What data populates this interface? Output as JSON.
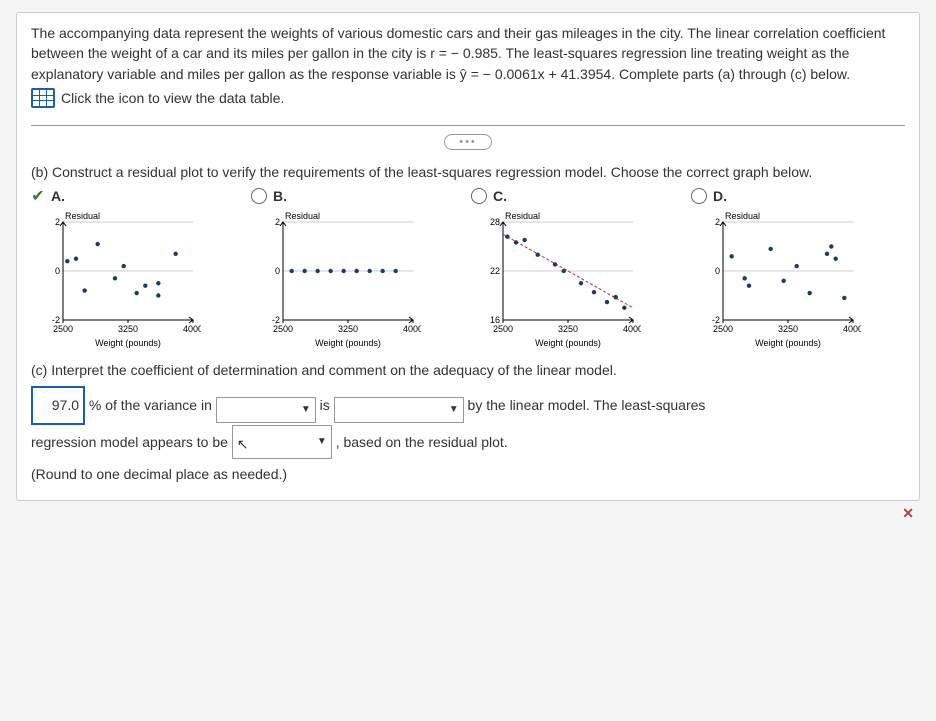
{
  "problem": {
    "p1": "The accompanying data represent the weights of various domestic cars and their gas mileages in the city. The linear correlation coefficient between the weight of a car and its miles per gallon in the city is r = − 0.985. The least-squares regression line treating weight as the explanatory variable and miles per gallon as the response variable is ŷ = − 0.0061x + 41.3954. Complete parts (a) through (c) below.",
    "data_link": "Click the icon to view the data table."
  },
  "part_b_prompt": "(b) Construct a residual plot to verify the requirements of the least-squares regression model. Choose the correct graph below.",
  "options": {
    "A": "A.",
    "B": "B.",
    "C": "C.",
    "D": "D."
  },
  "chart_labels": {
    "residual": "Residual",
    "weight": "Weight (pounds)"
  },
  "part_c": {
    "prompt": "(c) Interpret the coefficient of determination and comment on the adequacy of the linear model.",
    "value": "97.0",
    "t1": "% of the variance in",
    "t2": "is",
    "t3": "by the linear model. The least-squares",
    "t4": "regression model appears to be",
    "t5": ", based on the residual plot.",
    "round": "(Round to one decimal place as needed.)"
  },
  "chart_data": [
    {
      "type": "scatter",
      "option": "A",
      "selected": true,
      "xlabel": "Weight (pounds)",
      "ylabel": "Residual",
      "xlim": [
        2500,
        4000
      ],
      "ylim": [
        -2,
        2
      ],
      "xticks": [
        2500,
        3250,
        4000
      ],
      "yticks": [
        -2,
        0,
        2
      ],
      "points": [
        {
          "x": 2550,
          "y": 0.4
        },
        {
          "x": 2650,
          "y": 0.5
        },
        {
          "x": 2750,
          "y": -0.8
        },
        {
          "x": 2900,
          "y": 1.1
        },
        {
          "x": 3100,
          "y": -0.3
        },
        {
          "x": 3200,
          "y": 0.2
        },
        {
          "x": 3350,
          "y": -0.9
        },
        {
          "x": 3450,
          "y": -0.6
        },
        {
          "x": 3600,
          "y": -1.0
        },
        {
          "x": 3600,
          "y": -0.5
        },
        {
          "x": 3800,
          "y": 0.7
        }
      ]
    },
    {
      "type": "scatter",
      "option": "B",
      "selected": false,
      "xlabel": "Weight (pounds)",
      "ylabel": "Residual",
      "xlim": [
        2500,
        4000
      ],
      "ylim": [
        -2,
        2
      ],
      "xticks": [
        2500,
        3250,
        4000
      ],
      "yticks": [
        -2,
        0,
        2
      ],
      "points": [
        {
          "x": 2600,
          "y": 0
        },
        {
          "x": 2750,
          "y": 0
        },
        {
          "x": 2900,
          "y": 0
        },
        {
          "x": 3050,
          "y": 0
        },
        {
          "x": 3200,
          "y": 0
        },
        {
          "x": 3350,
          "y": 0
        },
        {
          "x": 3500,
          "y": 0
        },
        {
          "x": 3650,
          "y": 0
        },
        {
          "x": 3800,
          "y": 0
        }
      ]
    },
    {
      "type": "scatter",
      "option": "C",
      "selected": false,
      "xlabel": "Weight (pounds)",
      "ylabel": "Residual",
      "xlim": [
        2500,
        4000
      ],
      "ylim": [
        16,
        28
      ],
      "xticks": [
        2500,
        3250,
        4000
      ],
      "yticks": [
        16,
        22,
        28
      ],
      "trend": [
        {
          "x": 2500,
          "y": 26.5
        },
        {
          "x": 4000,
          "y": 17.5
        }
      ],
      "points": [
        {
          "x": 2550,
          "y": 26.2
        },
        {
          "x": 2650,
          "y": 25.5
        },
        {
          "x": 2750,
          "y": 25.8
        },
        {
          "x": 2900,
          "y": 24.0
        },
        {
          "x": 3100,
          "y": 22.8
        },
        {
          "x": 3200,
          "y": 22.0
        },
        {
          "x": 3400,
          "y": 20.5
        },
        {
          "x": 3550,
          "y": 19.4
        },
        {
          "x": 3700,
          "y": 18.2
        },
        {
          "x": 3800,
          "y": 18.8
        },
        {
          "x": 3900,
          "y": 17.5
        }
      ]
    },
    {
      "type": "scatter",
      "option": "D",
      "selected": false,
      "xlabel": "Weight (pounds)",
      "ylabel": "Residual",
      "xlim": [
        2500,
        4000
      ],
      "ylim": [
        -2,
        2
      ],
      "xticks": [
        2500,
        3250,
        4000
      ],
      "yticks": [
        -2,
        0,
        2
      ],
      "points": [
        {
          "x": 2600,
          "y": 0.6
        },
        {
          "x": 2750,
          "y": -0.3
        },
        {
          "x": 2800,
          "y": -0.6
        },
        {
          "x": 3050,
          "y": 0.9
        },
        {
          "x": 3200,
          "y": -0.4
        },
        {
          "x": 3350,
          "y": 0.2
        },
        {
          "x": 3500,
          "y": -0.9
        },
        {
          "x": 3700,
          "y": 0.7
        },
        {
          "x": 3750,
          "y": 1.0
        },
        {
          "x": 3800,
          "y": 0.5
        },
        {
          "x": 3900,
          "y": -1.1
        }
      ]
    }
  ]
}
